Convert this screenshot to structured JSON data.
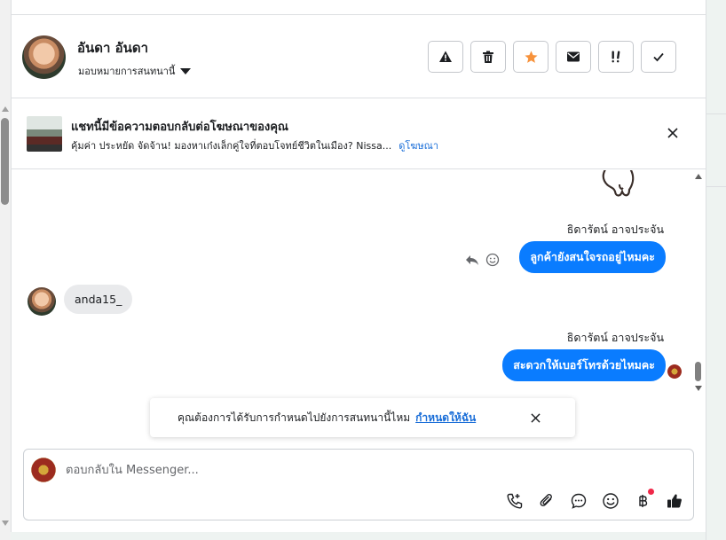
{
  "header": {
    "contact_name": "อันดา อันดา",
    "assign_label": "มอบหมายการสนทนานี้",
    "tool_buttons": [
      {
        "name": "mark-spam-button",
        "icon": "warning-icon"
      },
      {
        "name": "delete-button",
        "icon": "trash-icon"
      },
      {
        "name": "star-button",
        "icon": "star-icon"
      },
      {
        "name": "mark-unread-button",
        "icon": "envelope-icon"
      },
      {
        "name": "follow-up-button",
        "icon": "double-exclamation-icon"
      },
      {
        "name": "mark-done-button",
        "icon": "check-icon"
      }
    ]
  },
  "ad_banner": {
    "title": "แชทนี้มีข้อความตอบกลับต่อโฆษณาของคุณ",
    "subtitle": "คุ้มค่า ประหยัด จัดจ้าน! มองหาเก๋งเล็กคู่ใจที่ตอบโจทย์ชีวิตในเมือง? Nissa...",
    "link": "ดูโฆษณา"
  },
  "messages": [
    {
      "sender": "ธิดารัตน์ อาจประจัน",
      "text": "ลูกค้ายังสนใจรถอยู่ไหมคะ"
    },
    {
      "sender": "",
      "text": "anda15_"
    },
    {
      "sender": "ธิดารัตน์ อาจประจัน",
      "text": "สะดวกให้เบอร์โทรด้วยไหมคะ"
    }
  ],
  "assign_toast": {
    "text": "คุณต้องการได้รับการกำหนดไปยังการสนทนานี้ไหม",
    "link": "กำหนดให้ฉัน"
  },
  "composer": {
    "placeholder": "ตอบกลับใน Messenger...",
    "icons": [
      "phone-plus-icon",
      "paperclip-icon",
      "chat-bubble-icon",
      "emoji-icon",
      "baht-icon",
      "thumbs-up-icon"
    ]
  },
  "colors": {
    "accent": "#0a7cff",
    "link": "#1a6ed8",
    "star": "#f7923b",
    "badge": "#f02849"
  }
}
